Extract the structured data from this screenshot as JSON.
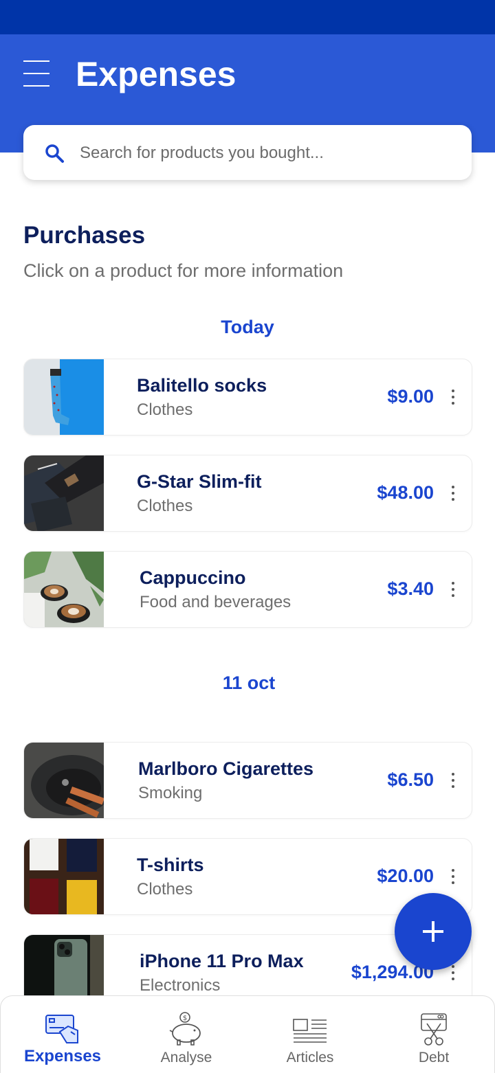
{
  "header": {
    "title": "Expenses"
  },
  "search": {
    "placeholder": "Search for products you bought..."
  },
  "purchases": {
    "title": "Purchases",
    "subtitle": "Click on a product for more information",
    "groups": [
      {
        "date": "Today",
        "items": [
          {
            "name": "Balitello socks",
            "category": "Clothes",
            "price": "$9.00"
          },
          {
            "name": "G-Star Slim-fit",
            "category": "Clothes",
            "price": "$48.00"
          },
          {
            "name": "Cappuccino",
            "category": "Food and beverages",
            "price": "$3.40"
          }
        ]
      },
      {
        "date": "11 oct",
        "items": [
          {
            "name": "Marlboro Cigarettes",
            "category": "Smoking",
            "price": "$6.50"
          },
          {
            "name": "T-shirts",
            "category": "Clothes",
            "price": "$20.00"
          },
          {
            "name": "iPhone 11 Pro Max",
            "category": "Electronics",
            "price": "$1,294.00"
          }
        ]
      }
    ]
  },
  "nav": {
    "items": [
      {
        "label": "Expenses",
        "icon": "credit-card-icon",
        "active": true
      },
      {
        "label": "Analyse",
        "icon": "piggy-bank-icon",
        "active": false
      },
      {
        "label": "Articles",
        "icon": "newspaper-icon",
        "active": false
      },
      {
        "label": "Debt",
        "icon": "cut-card-icon",
        "active": false
      }
    ]
  },
  "colors": {
    "status_bar": "#0034a8",
    "header": "#2b59d6",
    "accent": "#1a45cf",
    "heading": "#0d1f5c"
  }
}
